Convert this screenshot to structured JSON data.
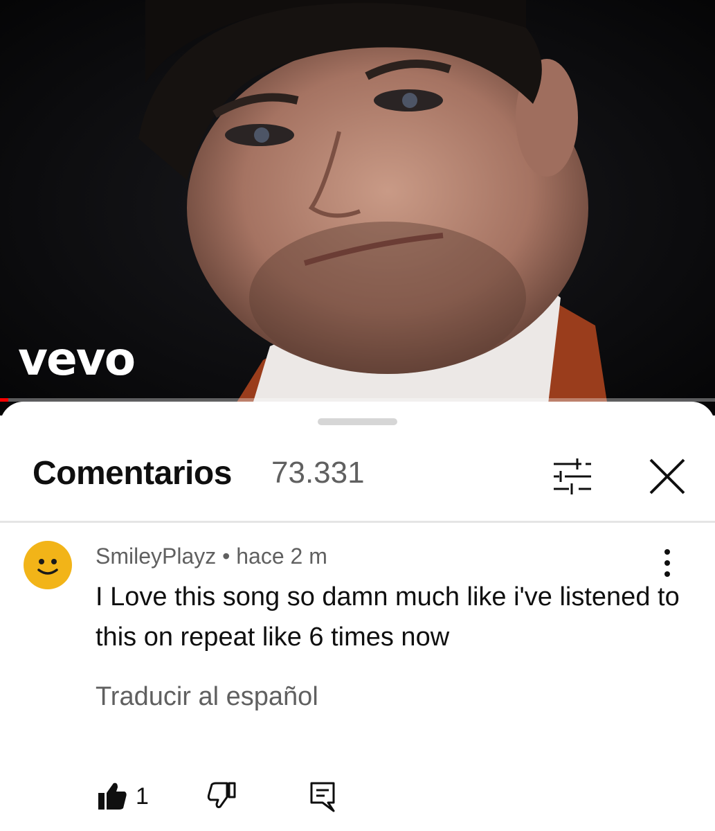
{
  "video": {
    "brand": "vevo",
    "progress_percent": 1.2,
    "progress_color": "#ff0000"
  },
  "comments_panel": {
    "title": "Comentarios",
    "count": "73.331",
    "filter_icon": "filter-sliders-icon",
    "close_icon": "close-icon"
  },
  "comment": {
    "avatar_icon": "smiley-face-icon",
    "avatar_color": "#f2b418",
    "meta": "SmileyPlayz • hace 2 m",
    "text": "I Love this song so damn much like i've listened to this on repeat like 6 times now",
    "translate_label": "Traducir al español",
    "like_count": "1",
    "like_icon": "thumbs-up-filled-icon",
    "dislike_icon": "thumbs-down-icon",
    "reply_icon": "reply-comment-icon",
    "more_icon": "more-vertical-icon"
  }
}
